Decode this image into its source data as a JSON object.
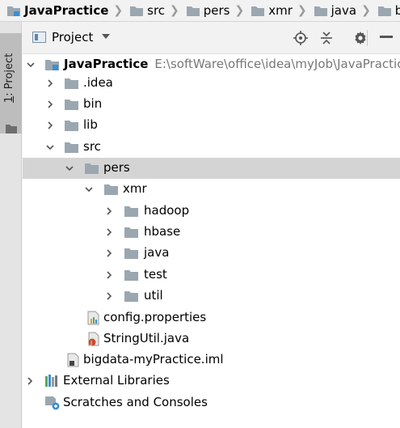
{
  "breadcrumb": {
    "items": [
      "JavaPractice",
      "src",
      "pers",
      "xmr",
      "java",
      "basis",
      ""
    ]
  },
  "toolstrip": {
    "tab_number": "1",
    "tab_label": ": Project"
  },
  "header": {
    "title": "Project",
    "icons": [
      "locate-icon",
      "collapse-all-icon",
      "gear-icon",
      "hide-icon"
    ]
  },
  "tree": {
    "root_label": "JavaPractice",
    "root_path": "E:\\softWare\\office\\idea\\myJob\\JavaPractice",
    "idea": ".idea",
    "bin": "bin",
    "lib": "lib",
    "src": "src",
    "pers": "pers",
    "xmr": "xmr",
    "hadoop": "hadoop",
    "hbase": "hbase",
    "java": "java",
    "test": "test",
    "util": "util",
    "config": "config.properties",
    "stringutil": "StringUtil.java",
    "iml": "bigdata-myPractice.iml",
    "external": "External Libraries",
    "scratches": "Scratches and Consoles"
  },
  "colors": {
    "selection": "#d4d4d4",
    "folder": "#9aa7b0",
    "path_text": "#777777"
  }
}
